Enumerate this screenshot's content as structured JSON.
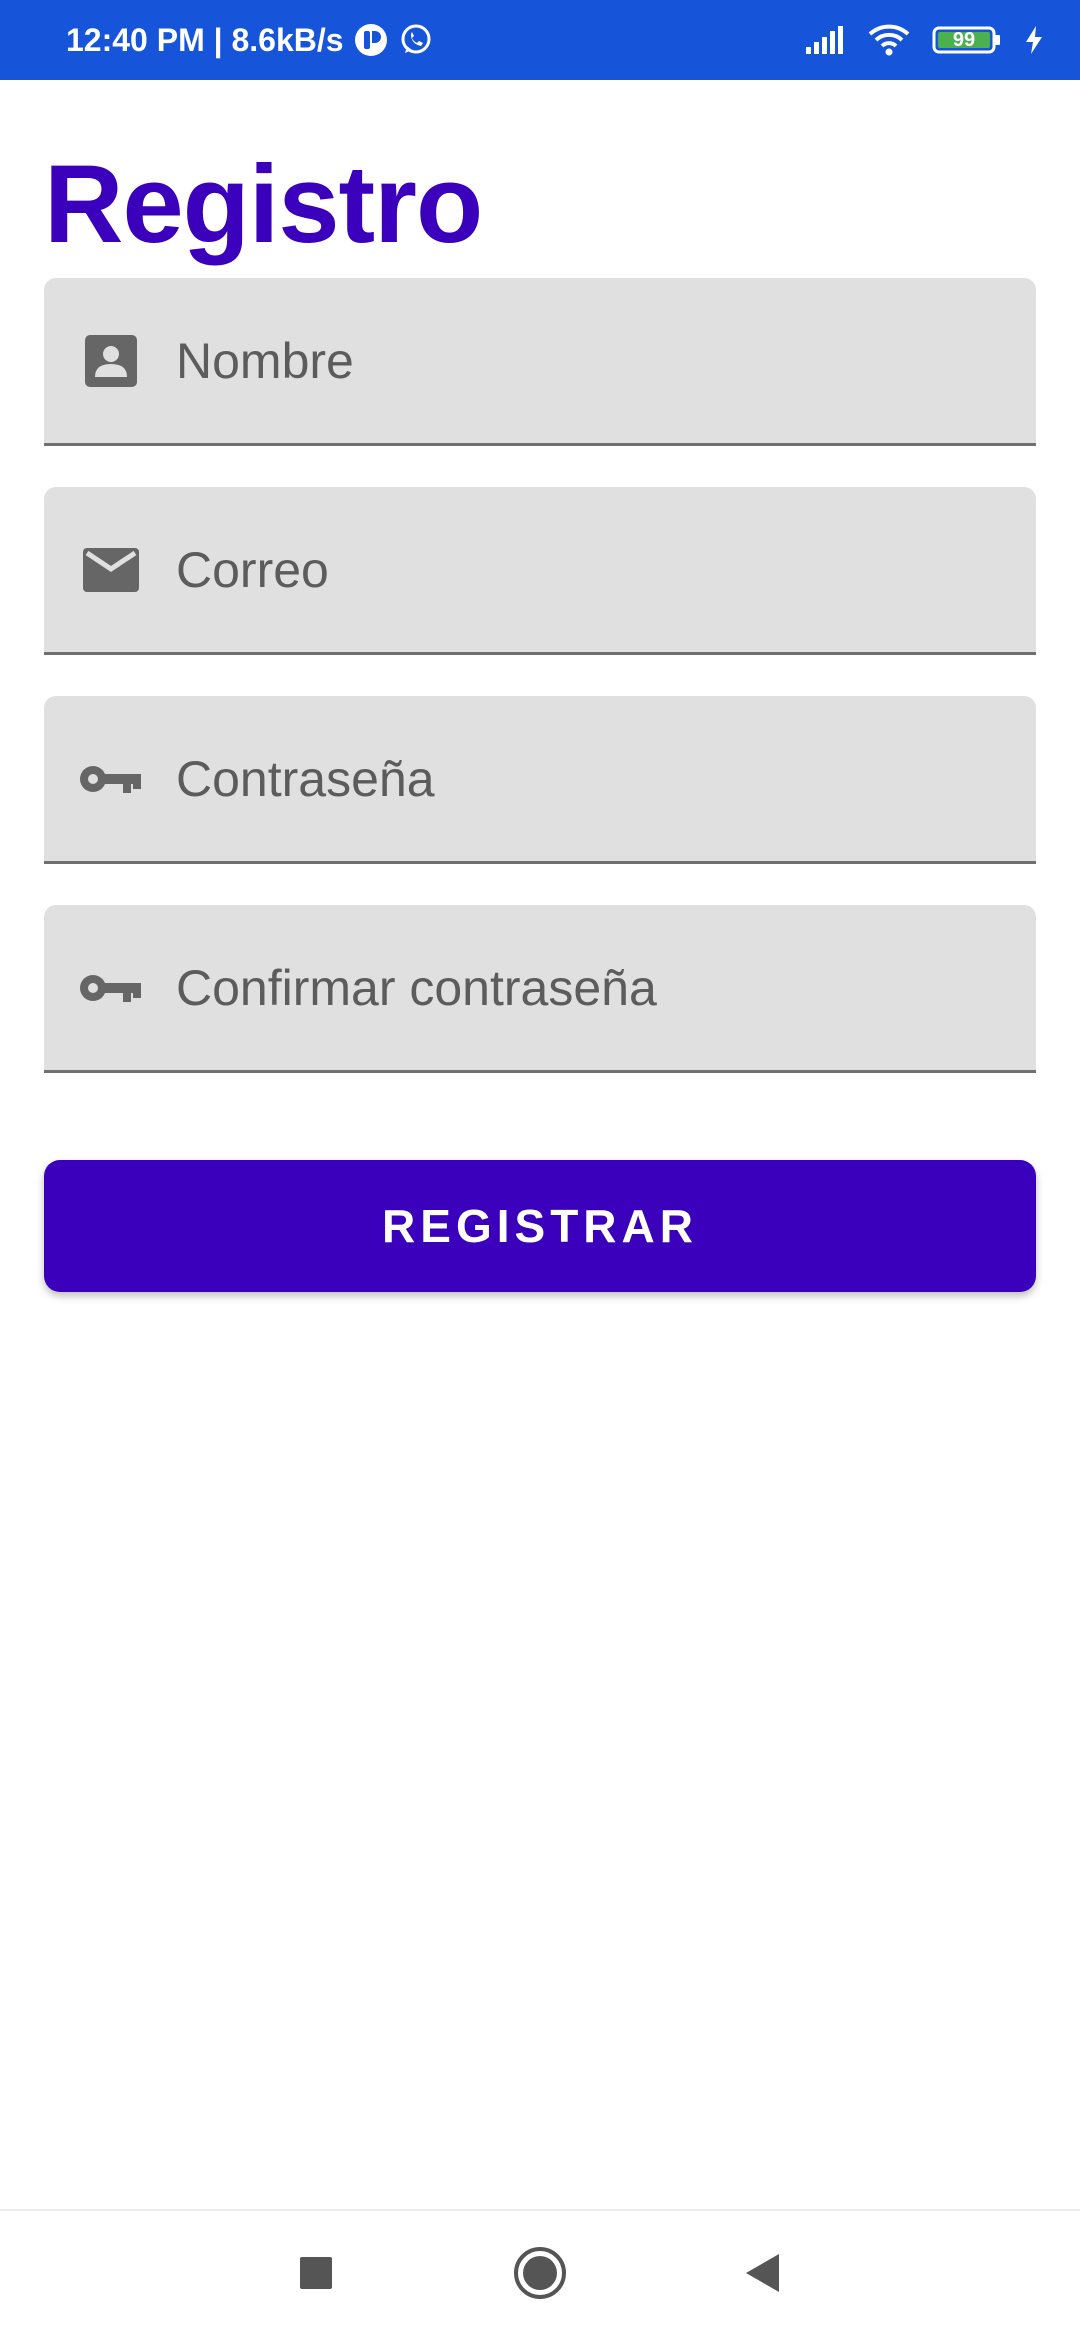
{
  "status_bar": {
    "time_speed": "12:40 PM | 8.6kB/s",
    "battery_level": "99",
    "icons": [
      "notification-app-icon",
      "whatsapp-icon",
      "signal-icon",
      "wifi-icon",
      "battery-icon",
      "charging-icon"
    ]
  },
  "page": {
    "title": "Registro"
  },
  "form": {
    "fields": [
      {
        "placeholder": "Nombre",
        "icon": "contact-card-icon"
      },
      {
        "placeholder": "Correo",
        "icon": "email-icon"
      },
      {
        "placeholder": "Contraseña",
        "icon": "key-icon"
      },
      {
        "placeholder": "Confirmar contraseña",
        "icon": "key-icon"
      }
    ],
    "submit_label": "REGISTRAR"
  },
  "nav_bar": {
    "buttons": [
      "recents-button",
      "home-button",
      "back-button"
    ]
  },
  "colors": {
    "status_bar": "#1655d9",
    "accent": "#3a00bb",
    "field_background": "#e0e0e0",
    "icon": "#666666"
  }
}
